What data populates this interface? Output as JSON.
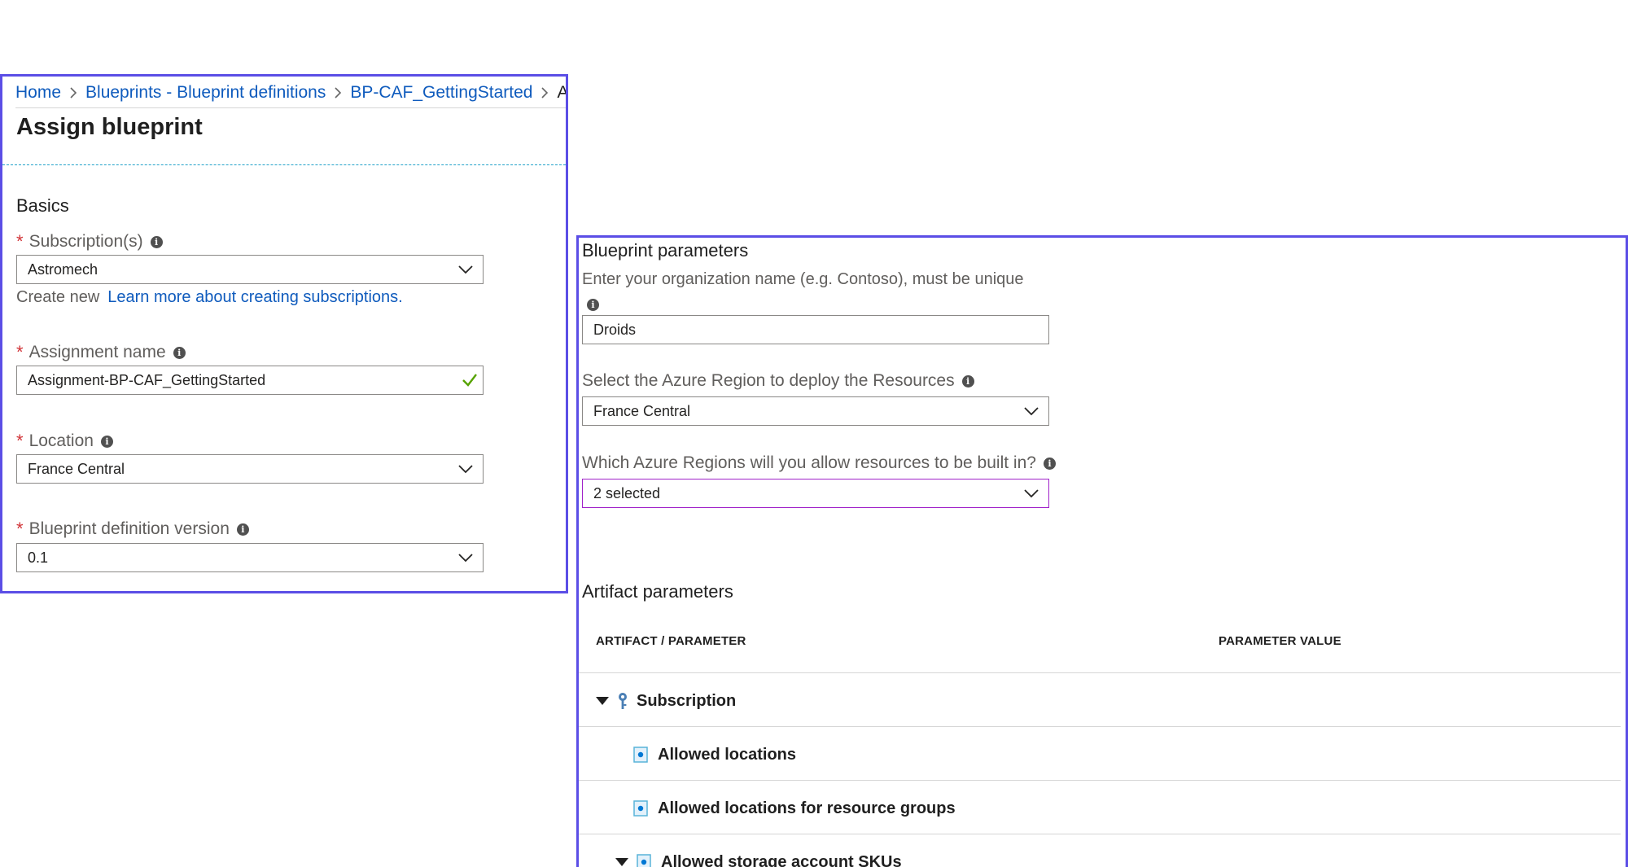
{
  "breadcrumb": {
    "items": [
      "Home",
      "Blueprints - Blueprint definitions",
      "BP-CAF_GettingStarted",
      "A"
    ]
  },
  "page": {
    "title": "Assign blueprint"
  },
  "basics": {
    "section_title": "Basics",
    "subscription": {
      "label": "Subscription(s)",
      "value": "Astromech",
      "create_new": "Create new",
      "learn_more": "Learn more about creating subscriptions."
    },
    "assignment_name": {
      "label": "Assignment name",
      "value": "Assignment-BP-CAF_GettingStarted"
    },
    "location": {
      "label": "Location",
      "value": "France Central"
    },
    "version": {
      "label": "Blueprint definition version",
      "value": "0.1"
    }
  },
  "blueprint_parameters": {
    "section_title": "Blueprint parameters",
    "org_name": {
      "label": "Enter your organization name (e.g. Contoso), must be unique",
      "value": "Droids"
    },
    "region": {
      "label": "Select the Azure Region to deploy the Resources",
      "value": "France Central"
    },
    "allowed_regions": {
      "label": "Which Azure Regions will you allow resources to be built in?",
      "value": "2 selected"
    }
  },
  "artifact_parameters": {
    "section_title": "Artifact parameters",
    "columns": [
      "ARTIFACT / PARAMETER",
      "PARAMETER VALUE"
    ],
    "rows": [
      {
        "label": "Subscription",
        "kind": "subscription"
      },
      {
        "label": "Allowed locations",
        "kind": "policy"
      },
      {
        "label": "Allowed locations for resource groups",
        "kind": "policy"
      },
      {
        "label": "Allowed storage account SKUs",
        "kind": "policy-group"
      }
    ]
  },
  "colors": {
    "panel_border": "#5b4ee6",
    "link": "#0f5bbd",
    "required": "#d13438",
    "valid_check": "#57a300",
    "active_select_border": "#a021c9",
    "dashed_rule": "#21a1c9"
  }
}
